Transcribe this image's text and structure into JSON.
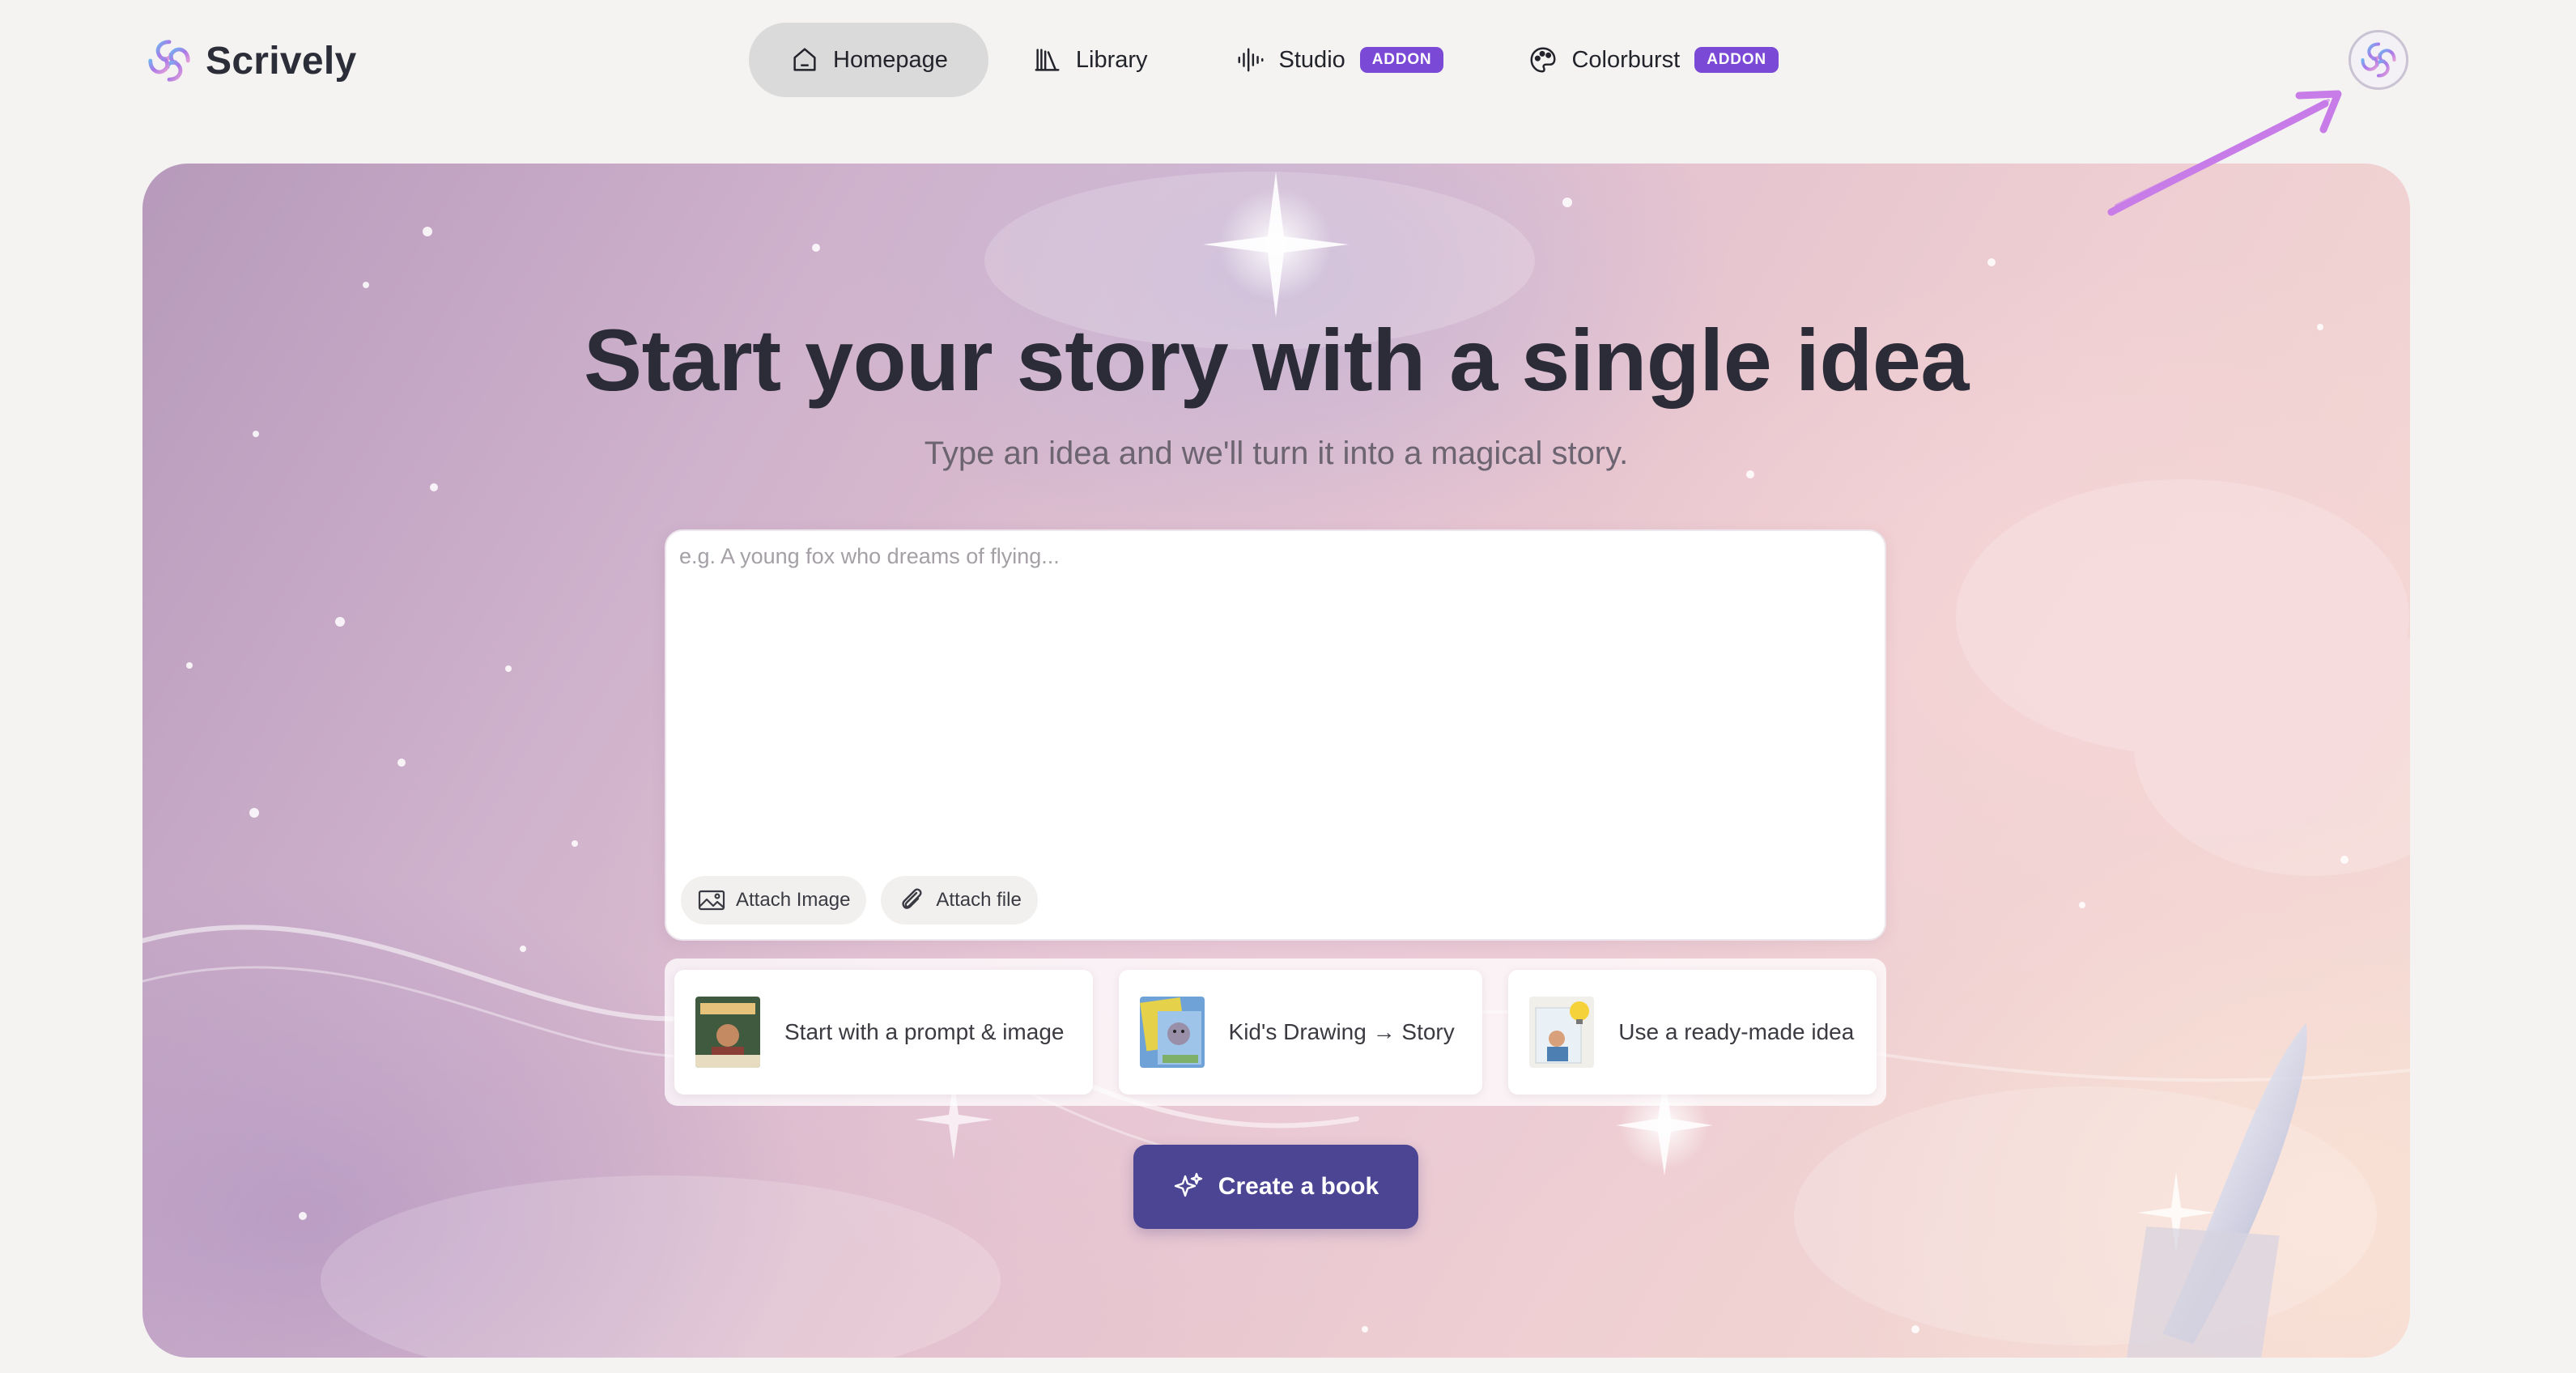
{
  "brand": {
    "name": "Scrively",
    "icon": "spiral-logo-icon"
  },
  "nav": {
    "items": [
      {
        "label": "Homepage",
        "icon": "home-icon",
        "active": true
      },
      {
        "label": "Library",
        "icon": "books-icon"
      },
      {
        "label": "Studio",
        "icon": "waveform-icon",
        "badge": "ADDON"
      },
      {
        "label": "Colorburst",
        "icon": "palette-icon",
        "badge": "ADDON"
      }
    ]
  },
  "avatar": {
    "icon": "spiral-logo-icon"
  },
  "hero": {
    "title": "Start your story with a single idea",
    "subtitle": "Type an idea and we'll turn it into a magical story."
  },
  "prompt": {
    "value": "",
    "placeholder": "e.g. A young fox who dreams of flying..."
  },
  "attach": {
    "image_label": "Attach Image",
    "file_label": "Attach file"
  },
  "suggestions": [
    {
      "label": "Start with a prompt & image",
      "icon": "book-cover-thumbnail"
    },
    {
      "label": "Kid's Drawing → Story",
      "icon": "drawing-thumbnail"
    },
    {
      "label": "Use a ready-made idea",
      "icon": "idea-book-thumbnail"
    }
  ],
  "cta": {
    "label": "Create a book",
    "icon": "sparkles-icon"
  },
  "colors": {
    "accent": "#4c4594",
    "badge": "#7a49d6",
    "active_nav": "#dadada",
    "background": "#f4f3f1"
  }
}
